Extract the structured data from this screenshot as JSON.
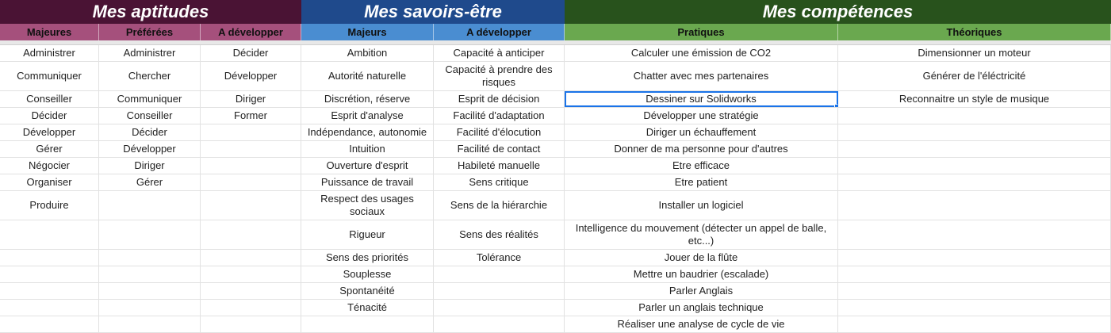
{
  "groups": {
    "aptitudes": "Mes aptitudes",
    "savoirs": "Mes savoirs-être",
    "competences": "Mes compétences"
  },
  "subheaders": {
    "apt_majeures": "Majeures",
    "apt_preferees": "Préférées",
    "apt_developper": "A développer",
    "sav_majeurs": "Majeurs",
    "sav_developper": "A développer",
    "comp_pratiques": "Pratiques",
    "comp_theoriques": "Théoriques"
  },
  "rows": [
    [
      "Administrer",
      "Administrer",
      "Décider",
      "Ambition",
      "Capacité à anticiper",
      "Calculer une émission de CO2",
      "Dimensionner un moteur"
    ],
    [
      "Communiquer",
      "Chercher",
      "Développer",
      "Autorité naturelle",
      "Capacité à prendre des risques",
      "Chatter avec mes partenaires",
      "Générer de l'éléctricité"
    ],
    [
      "Conseiller",
      "Communiquer",
      "Diriger",
      "Discrétion, réserve",
      "Esprit de décision",
      "Dessiner sur Solidworks",
      "Reconnaitre un style de musique"
    ],
    [
      "Décider",
      "Conseiller",
      "Former",
      "Esprit d'analyse",
      "Facilité d'adaptation",
      "Développer une stratégie",
      ""
    ],
    [
      "Développer",
      "Décider",
      "",
      "Indépendance, autonomie",
      "Facilité d'élocution",
      "Diriger un échauffement",
      ""
    ],
    [
      "Gérer",
      "Développer",
      "",
      "Intuition",
      "Facilité de contact",
      "Donner de ma personne pour d'autres",
      ""
    ],
    [
      "Négocier",
      "Diriger",
      "",
      "Ouverture d'esprit",
      "Habileté manuelle",
      "Etre efficace",
      ""
    ],
    [
      "Organiser",
      "Gérer",
      "",
      "Puissance de travail",
      "Sens critique",
      "Etre patient",
      ""
    ],
    [
      "Produire",
      "",
      "",
      "Respect des usages sociaux",
      "Sens de la hiérarchie",
      "Installer un logiciel",
      ""
    ],
    [
      "",
      "",
      "",
      "Rigueur",
      "Sens des réalités",
      "Intelligence du mouvement (détecter un appel de balle, etc...)",
      ""
    ],
    [
      "",
      "",
      "",
      "Sens des priorités",
      "Tolérance",
      "Jouer de la flûte",
      ""
    ],
    [
      "",
      "",
      "",
      "Souplesse",
      "",
      "Mettre un baudrier (escalade)",
      ""
    ],
    [
      "",
      "",
      "",
      "Spontanéité",
      "",
      "Parler Anglais",
      ""
    ],
    [
      "",
      "",
      "",
      "Ténacité",
      "",
      "Parler un anglais technique",
      ""
    ],
    [
      "",
      "",
      "",
      "",
      "",
      "Réaliser une analyse de cycle de vie",
      ""
    ]
  ],
  "colors": {
    "aptitudes_header": "#4a1334",
    "aptitudes_sub": "#a5507c",
    "savoirs_header": "#1f4a8c",
    "savoirs_sub": "#4a8dd1",
    "competences_header": "#28521c",
    "competences_sub": "#6aa84f",
    "selection": "#1a73e8"
  },
  "selected_cell": {
    "row": 2,
    "col": 5
  }
}
